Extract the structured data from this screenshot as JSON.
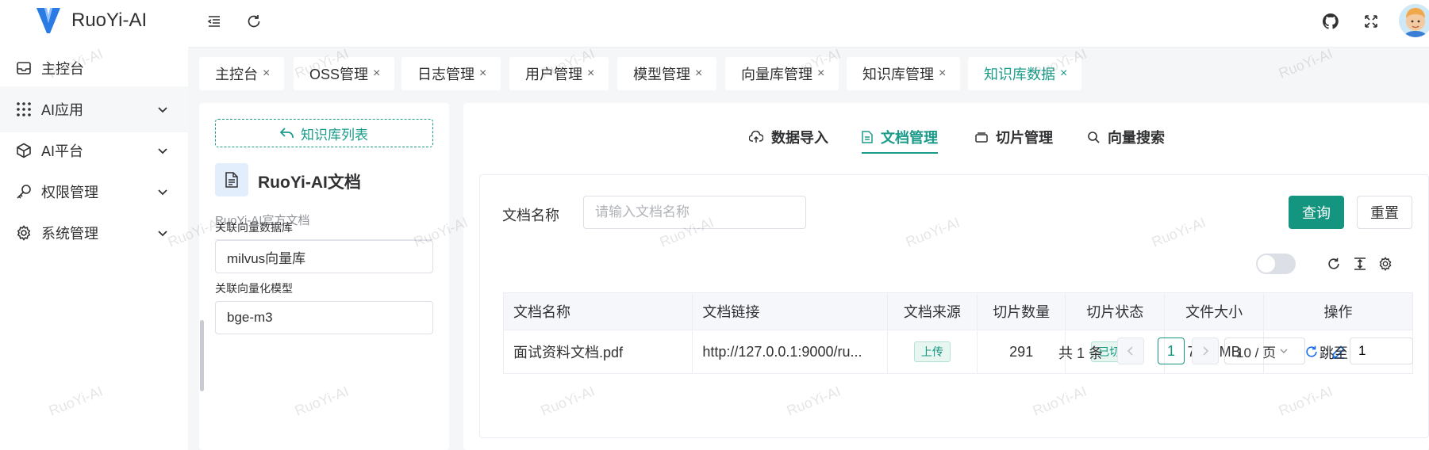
{
  "app": {
    "logo_text": "RuoYi-AI"
  },
  "sidebar": {
    "items": [
      {
        "label": "主控台",
        "icon": "dashboard-icon"
      },
      {
        "label": "AI应用",
        "icon": "grid-icon"
      },
      {
        "label": "AI平台",
        "icon": "cube-icon"
      },
      {
        "label": "权限管理",
        "icon": "key-icon"
      },
      {
        "label": "系统管理",
        "icon": "gear-icon"
      }
    ]
  },
  "tabs": [
    {
      "label": "主控台"
    },
    {
      "label": "OSS管理"
    },
    {
      "label": "日志管理"
    },
    {
      "label": "用户管理"
    },
    {
      "label": "模型管理"
    },
    {
      "label": "向量库管理"
    },
    {
      "label": "知识库管理"
    },
    {
      "label": "知识库数据",
      "active": true
    }
  ],
  "tab_close_glyph": "×",
  "left_panel": {
    "back_button": "知识库列表",
    "kb_title": "RuoYi-AI文档",
    "kb_desc": "RuoYi-AI官方文档",
    "vector_db_label": "关联向量数据库",
    "vector_db_value": "milvus向量库",
    "vector_model_label": "关联向量化模型",
    "vector_model_value": "bge-m3"
  },
  "content_tabs": [
    {
      "label": "数据导入",
      "icon": "cloud-upload-icon"
    },
    {
      "label": "文档管理",
      "icon": "document-icon",
      "active": true
    },
    {
      "label": "切片管理",
      "icon": "slices-icon"
    },
    {
      "label": "向量搜索",
      "icon": "search-icon"
    }
  ],
  "query": {
    "label": "文档名称",
    "placeholder": "请输入文档名称",
    "search_button": "查询",
    "reset_button": "重置"
  },
  "table": {
    "headers": [
      "文档名称",
      "文档链接",
      "文档来源",
      "切片数量",
      "切片状态",
      "文件大小",
      "操作"
    ],
    "rows": [
      {
        "name": "面试资料文档.pdf",
        "link": "http://127.0.0.1:9000/ru...",
        "source": "上传",
        "slices": "291",
        "status": "已切片",
        "size": "7.73 MB"
      }
    ]
  },
  "pagination": {
    "total": "共 1 条",
    "current_page": "1",
    "page_size": "10 / 页",
    "jump_label": "跳至",
    "jump_value": "1"
  },
  "watermark": "RuoYi-AI",
  "colors": {
    "primary": "#13957f",
    "accent": "#1a9b8a",
    "danger": "#e0475f",
    "link": "#1b6ee8"
  }
}
